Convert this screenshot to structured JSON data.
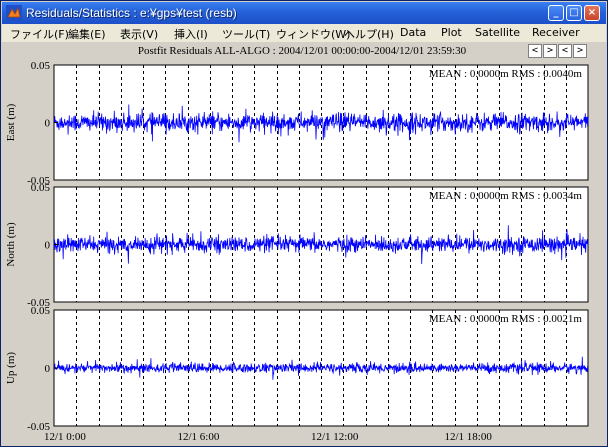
{
  "window": {
    "title": "Residuals/Statistics : e:¥gps¥test (resb)",
    "buttons": {
      "minimize": "_",
      "maximize": "□",
      "close": "×"
    }
  },
  "menu": [
    {
      "label": "ファイル(F)",
      "name": "menu-file"
    },
    {
      "label": "編集(E)",
      "name": "menu-edit"
    },
    {
      "label": "表示(V)",
      "name": "menu-view"
    },
    {
      "label": "挿入(I)",
      "name": "menu-insert"
    },
    {
      "label": "ツール(T)",
      "name": "menu-tools"
    },
    {
      "label": "ウィンドウ(W)",
      "name": "menu-window"
    },
    {
      "label": "ヘルプ(H)",
      "name": "menu-help"
    },
    {
      "label": "Data",
      "name": "menu-data"
    },
    {
      "label": "Plot",
      "name": "menu-plot"
    },
    {
      "label": "Satellite",
      "name": "menu-satellite"
    },
    {
      "label": "Receiver",
      "name": "menu-receiver"
    }
  ],
  "plot_title": "Postfit Residuals ALL-ALGO : 2004/12/01 00:00:00-2004/12/01 23:59:30",
  "nav_buttons": [
    "<",
    ">",
    "<",
    ">"
  ],
  "colors": {
    "series": "#0000ff",
    "axes": "#000000",
    "plot_bg": "#ffffff"
  },
  "chart_data": [
    {
      "type": "line",
      "ylabel": "East (m)",
      "ylim": [
        -0.05,
        0.05
      ],
      "yticks": [
        "0.05",
        "0",
        "-0.05"
      ],
      "stats": "MEAN : 0.0000m RMS : 0.0040m",
      "mean_m": 0.0,
      "rms_m": 0.004,
      "series": [
        {
          "values_summary": "residual noise, approx ±0.02 m, spikes to ±0.04 m"
        }
      ]
    },
    {
      "type": "line",
      "ylabel": "North (m)",
      "ylim": [
        -0.05,
        0.05
      ],
      "yticks": [
        "0.05",
        "0",
        "-0.05"
      ],
      "stats": "MEAN : 0.0000m RMS : 0.0034m",
      "mean_m": 0.0,
      "rms_m": 0.0034,
      "series": [
        {
          "values_summary": "residual noise, approx ±0.015 m, spikes to ±0.045 m"
        }
      ]
    },
    {
      "type": "line",
      "ylabel": "Up (m)",
      "ylim": [
        -0.05,
        0.05
      ],
      "yticks": [
        "0.05",
        "0",
        "-0.05"
      ],
      "stats": "MEAN : 0.0000m RMS : 0.0021m",
      "mean_m": 0.0,
      "rms_m": 0.0021,
      "series": [
        {
          "values_summary": "residual noise, approx ±0.007 m"
        }
      ]
    }
  ],
  "x_axis": {
    "ticks": [
      "12/1  0:00",
      "12/1  6:00",
      "12/1 12:00",
      "12/1 18:00"
    ],
    "range_hours": [
      0,
      24
    ],
    "tick_hours": [
      0,
      6,
      12,
      18
    ],
    "gridline_interval_hours": 1
  }
}
